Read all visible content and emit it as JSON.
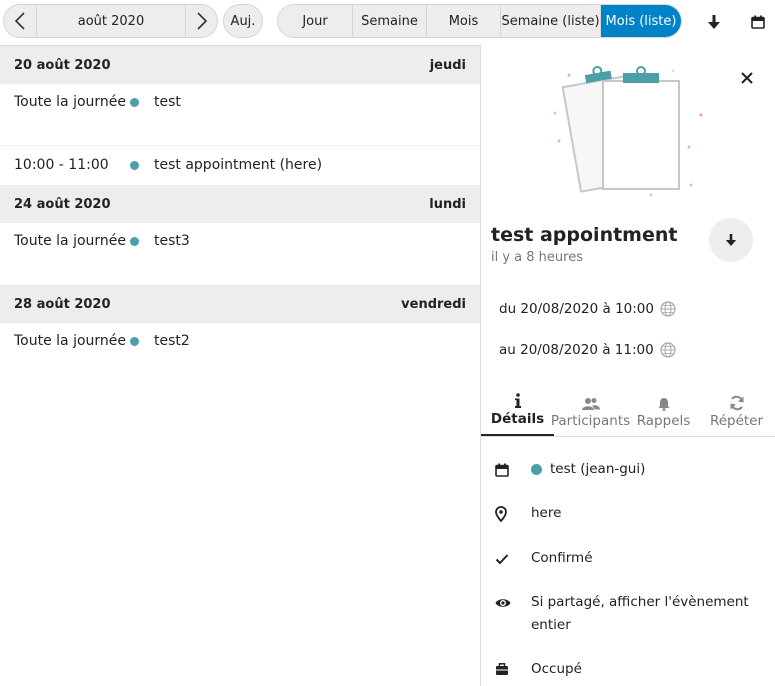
{
  "toolbar": {
    "month_label": "août 2020",
    "today_label": "Auj.",
    "views": [
      "Jour",
      "Semaine",
      "Mois",
      "Semaine (liste)",
      "Mois (liste)"
    ],
    "active_view": "Mois (liste)"
  },
  "colors": {
    "accent": "#0082c9",
    "calendar": "#4a9fa8"
  },
  "list": {
    "days": [
      {
        "date": "20 août 2020",
        "weekday": "jeudi",
        "events": [
          {
            "time": "Toute la journée",
            "title": "test"
          },
          {
            "time": "10:00 - 11:00",
            "title": "test appointment (here)"
          }
        ]
      },
      {
        "date": "24 août 2020",
        "weekday": "lundi",
        "events": [
          {
            "time": "Toute la journée",
            "title": "test3"
          }
        ]
      },
      {
        "date": "28 août 2020",
        "weekday": "vendredi",
        "events": [
          {
            "time": "Toute la journée",
            "title": "test2"
          }
        ]
      }
    ]
  },
  "sidebar": {
    "title": "test appointment",
    "subtitle": "il y a 8 heures",
    "from": "du 20/08/2020 à 10:00",
    "to": "au 20/08/2020 à 11:00",
    "tabs": [
      {
        "label": "Détails",
        "icon": "info-icon"
      },
      {
        "label": "Participants",
        "icon": "people-icon"
      },
      {
        "label": "Rappels",
        "icon": "bell-icon"
      },
      {
        "label": "Répéter",
        "icon": "repeat-icon"
      }
    ],
    "details": {
      "calendar": "test (jean-gui)",
      "location": "here",
      "status": "Confirmé",
      "visibility": "Si partagé, afficher l'évènement entier",
      "availability": "Occupé"
    }
  }
}
